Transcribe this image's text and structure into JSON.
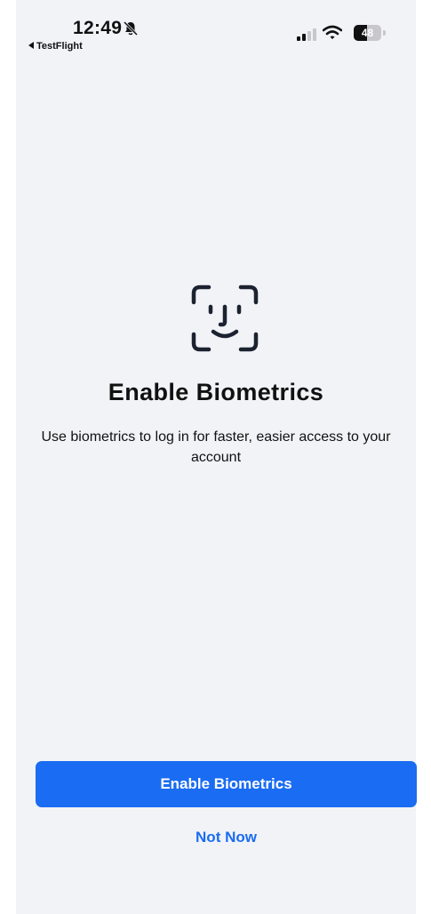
{
  "status_bar": {
    "time": "12:49",
    "back_app": "TestFlight",
    "battery_level": "48",
    "battery_fraction": 0.48,
    "icons": [
      "bell-slash-icon",
      "signal-icon",
      "wifi-icon",
      "battery-icon"
    ]
  },
  "main": {
    "icon": "face-id-icon",
    "title": "Enable Biometrics",
    "subtitle": "Use biometrics to log in for faster, easier access to your account"
  },
  "actions": {
    "primary_label": "Enable Biometrics",
    "secondary_label": "Not Now"
  },
  "colors": {
    "accent": "#1a6cf2",
    "background": "#f2f3f7",
    "text": "#111111"
  }
}
